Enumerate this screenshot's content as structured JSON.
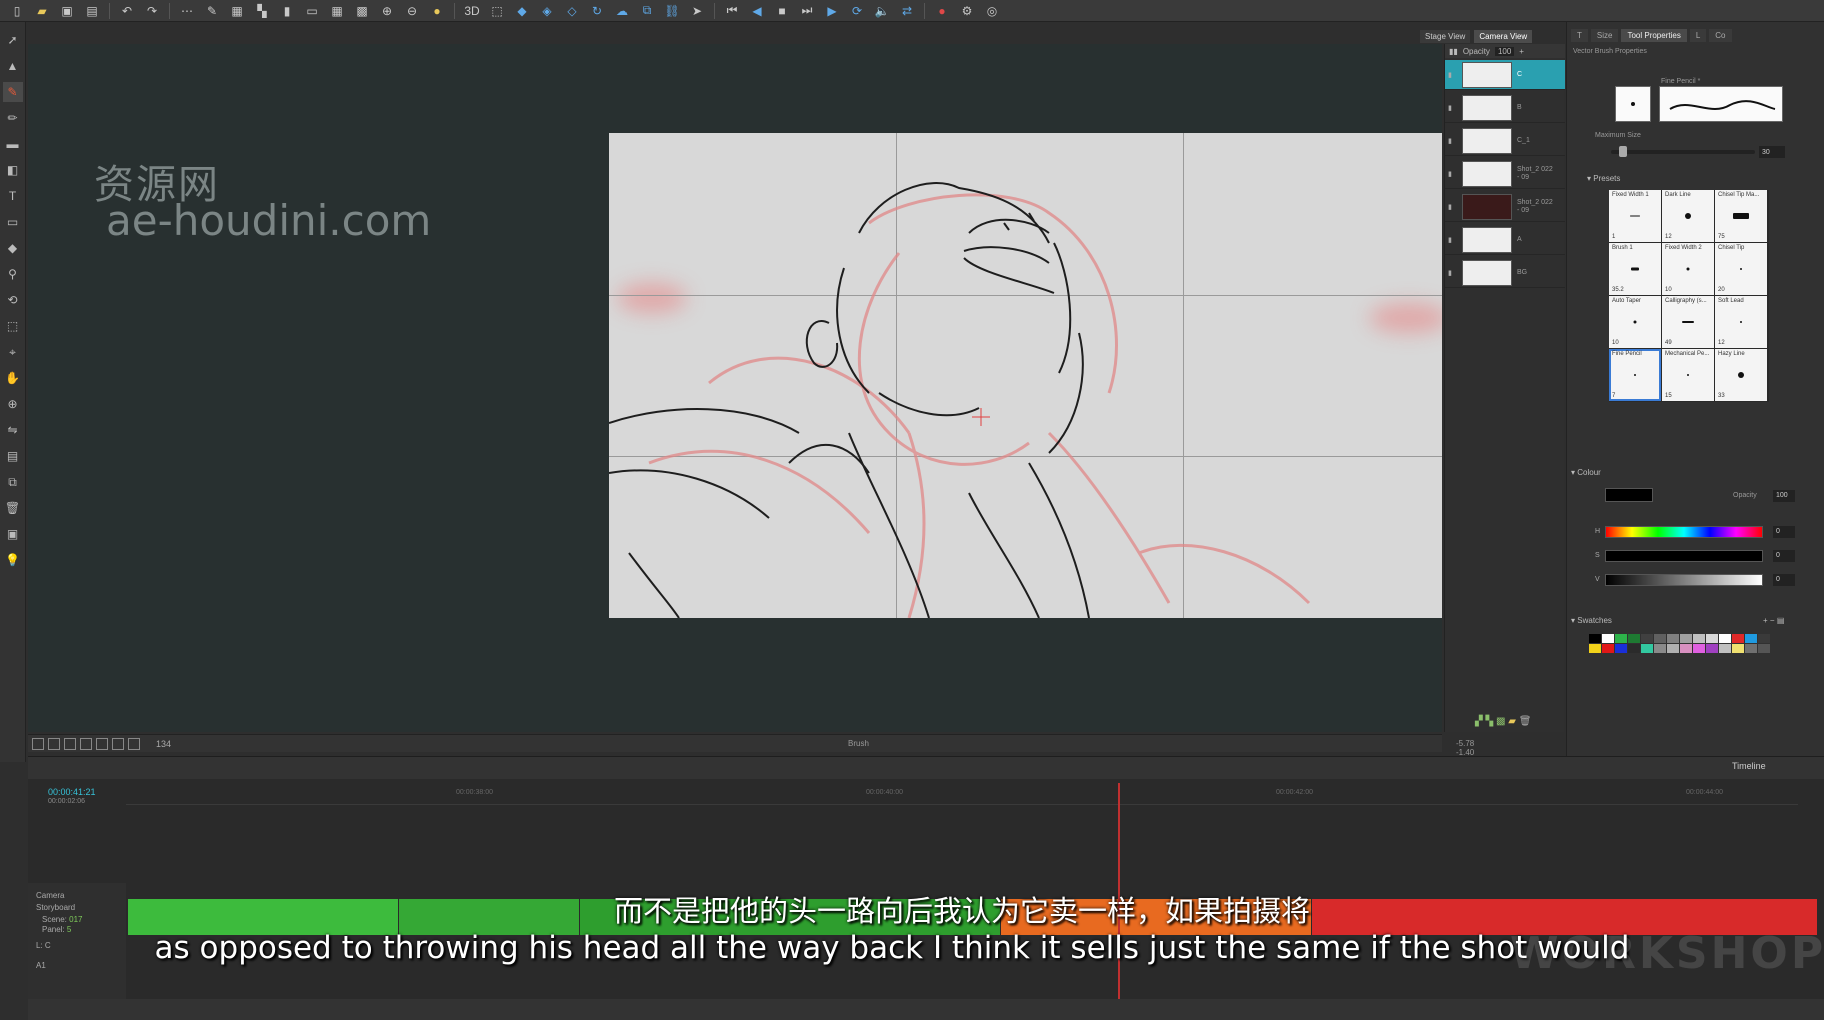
{
  "toolbar": {
    "icons": [
      "new-icon",
      "open-icon",
      "save-icon",
      "save-all-icon",
      "undo-icon",
      "redo-icon",
      "more-icon",
      "pen-icon",
      "grid-icon",
      "layout-icon",
      "zoom-in-icon",
      "zoom-out-icon",
      "hand-icon",
      "3d-icon",
      "camera-icon",
      "play-icon",
      "loop-icon",
      "sound-icon",
      "record-icon"
    ],
    "label_3d": "3D"
  },
  "stage": {
    "tabs": [
      "Stage View",
      "Camera View"
    ],
    "watermark_line1": "资源网",
    "watermark_line2": "ae-houdini.com"
  },
  "stage_bar": {
    "zoom": "134",
    "center_text": "Brush",
    "right_text": "-5.78  -1.40"
  },
  "layers": {
    "opacity_label": "Opacity",
    "opacity_value": "100",
    "rows": [
      {
        "name": "C",
        "selected": true,
        "dark": false
      },
      {
        "name": "B",
        "selected": false,
        "dark": false
      },
      {
        "name": "C_1",
        "selected": false,
        "dark": false
      },
      {
        "name": "Shot_2 022 - 09",
        "selected": false,
        "dark": false
      },
      {
        "name": "Shot_2 022 - 09",
        "selected": false,
        "dark": true
      },
      {
        "name": "A",
        "selected": false,
        "dark": false
      },
      {
        "name": "BG",
        "selected": false,
        "dark": false
      }
    ]
  },
  "tool_properties": {
    "tabs": [
      "T",
      "Size",
      "Tool Properties",
      "L",
      "Co"
    ],
    "header": "Vector Brush Properties",
    "brush_name": "Fine Pencil *",
    "max_size_label": "Maximum Size",
    "max_size_value": "30",
    "presets_label": "Presets",
    "presets": [
      {
        "name": "Fixed Width 1",
        "size": "1",
        "selected": false
      },
      {
        "name": "Dark Line",
        "size": "12",
        "selected": false
      },
      {
        "name": "Chisel Tip Ma...",
        "size": "75",
        "selected": false
      },
      {
        "name": "Brush 1",
        "size": "35.2",
        "selected": false
      },
      {
        "name": "Fixed Width 2",
        "size": "10",
        "selected": false
      },
      {
        "name": "Chisel Tip",
        "size": "20",
        "selected": false
      },
      {
        "name": "Auto Taper",
        "size": "10",
        "selected": false
      },
      {
        "name": "Calligraphy (s...",
        "size": "49",
        "selected": false
      },
      {
        "name": "Soft Lead",
        "size": "12",
        "selected": false
      },
      {
        "name": "Fine Pencil",
        "size": "7",
        "selected": true
      },
      {
        "name": "Mechanical Pe...",
        "size": "15",
        "selected": false
      },
      {
        "name": "Hazy Line",
        "size": "33",
        "selected": false
      }
    ]
  },
  "colour": {
    "label": "Colour",
    "opacity_label": "Opacity",
    "opacity_value": "100",
    "h_label": "H",
    "h_value": "0",
    "s_label": "S",
    "s_value": "0",
    "v_label": "V",
    "v_value": "0",
    "current": "#000000"
  },
  "swatches": {
    "label": "Swatches",
    "colors": [
      "#000000",
      "#ffffff",
      "#2db34a",
      "#1e7a32",
      "#404040",
      "#606060",
      "#808080",
      "#a0a0a0",
      "#c0c0c0",
      "#d8d8d8",
      "#ffffff",
      "#e02828",
      "#1f9ae0",
      "#3a3a3a",
      "#f2d21a",
      "#e01818",
      "#1a2fd8",
      "#2b2b2b",
      "#32c8a0",
      "#8a8a8a",
      "#b0b0b0",
      "#d890c0",
      "#e060e0",
      "#a040c0",
      "#c0c0c0",
      "#f0e070",
      "#707070",
      "#555555"
    ]
  },
  "timeline": {
    "title": "Timeline",
    "current_time": "00:00:41:21",
    "current_time_sub": "00:00:02:06",
    "ticks": [
      "00:00:38:00",
      "00:00:40:00",
      "00:00:42:00",
      "00:00:44:00"
    ],
    "track_camera": "Camera",
    "track_storyboard": "Storyboard",
    "scene_label": "Scene:",
    "scene_value": "017",
    "panel_label": "Panel:",
    "panel_value": "5",
    "track_lc": "L: C",
    "track_audio": "A1"
  },
  "subtitles": {
    "chinese": "而不是把他的头一路向后我认为它卖一样，如果拍摄将",
    "english": "as opposed to throwing his head all the way back I think it sells just the same if the shot would"
  },
  "corner_watermark": "WORKSHOP"
}
